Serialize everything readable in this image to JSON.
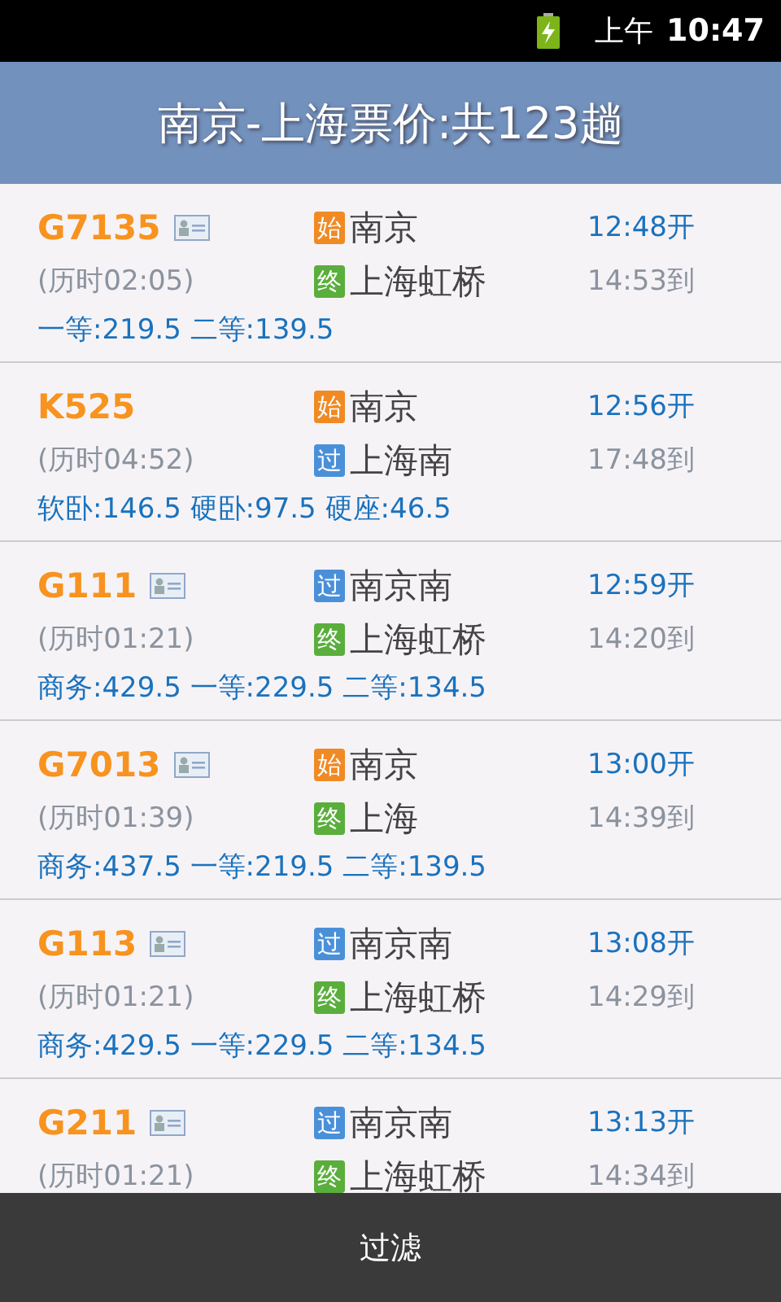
{
  "status_bar": {
    "period": "上午",
    "time": "10:47"
  },
  "header": {
    "title": "南京-上海票价:共123趟"
  },
  "trains": [
    {
      "number": "G7135",
      "id_card": true,
      "duration": "(历时02:05)",
      "from": {
        "kind": "start",
        "badge": "始",
        "station": "南京",
        "time": "12:48开"
      },
      "to": {
        "kind": "end",
        "badge": "终",
        "station": "上海虹桥",
        "time": "14:53到"
      },
      "prices": "一等:219.5 二等:139.5"
    },
    {
      "number": "K525",
      "id_card": false,
      "duration": "(历时04:52)",
      "from": {
        "kind": "start",
        "badge": "始",
        "station": "南京",
        "time": "12:56开"
      },
      "to": {
        "kind": "pass",
        "badge": "过",
        "station": "上海南",
        "time": "17:48到"
      },
      "prices": "软卧:146.5 硬卧:97.5 硬座:46.5"
    },
    {
      "number": "G111",
      "id_card": true,
      "duration": "(历时01:21)",
      "from": {
        "kind": "pass",
        "badge": "过",
        "station": "南京南",
        "time": "12:59开"
      },
      "to": {
        "kind": "end",
        "badge": "终",
        "station": "上海虹桥",
        "time": "14:20到"
      },
      "prices": "商务:429.5 一等:229.5 二等:134.5"
    },
    {
      "number": "G7013",
      "id_card": true,
      "duration": "(历时01:39)",
      "from": {
        "kind": "start",
        "badge": "始",
        "station": "南京",
        "time": "13:00开"
      },
      "to": {
        "kind": "end",
        "badge": "终",
        "station": "上海",
        "time": "14:39到"
      },
      "prices": "商务:437.5 一等:219.5 二等:139.5"
    },
    {
      "number": "G113",
      "id_card": true,
      "duration": "(历时01:21)",
      "from": {
        "kind": "pass",
        "badge": "过",
        "station": "南京南",
        "time": "13:08开"
      },
      "to": {
        "kind": "end",
        "badge": "终",
        "station": "上海虹桥",
        "time": "14:29到"
      },
      "prices": "商务:429.5 一等:229.5 二等:134.5"
    },
    {
      "number": "G211",
      "id_card": true,
      "duration": "(历时01:21)",
      "from": {
        "kind": "pass",
        "badge": "过",
        "station": "南京南",
        "time": "13:13开"
      },
      "to": {
        "kind": "end",
        "badge": "终",
        "station": "上海虹桥",
        "time": "14:34到"
      }
    }
  ],
  "bottom_button": {
    "label": "过滤"
  }
}
